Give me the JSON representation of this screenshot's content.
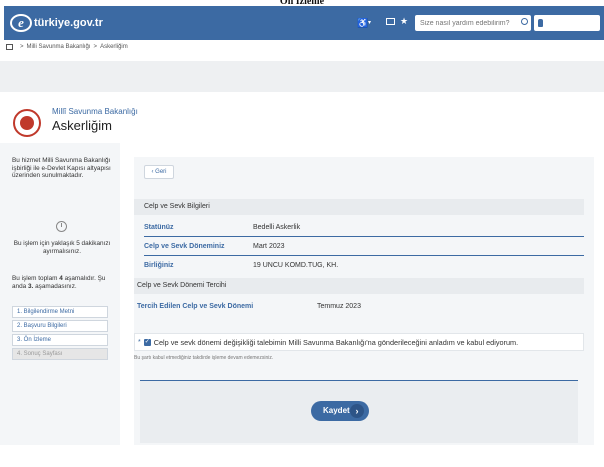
{
  "page_caption": "Ön İzleme",
  "header": {
    "logo_mark": "e",
    "logo_text": "türkiye.gov.tr",
    "accessibility_icon": "♿",
    "accessibility_caret": "▾",
    "favorite_icon": "★",
    "search_placeholder": "Size nasıl yardım edebilirim?"
  },
  "breadcrumb": {
    "sep": ">",
    "items": [
      "Milli Savunma Bakanlığı",
      "Askerliğim"
    ]
  },
  "institution": {
    "name": "Millî Savunma Bakanlığı",
    "service": "Askerliğim"
  },
  "sidebar": {
    "description": "Bu hizmet Milli Savunma Bakanlığı işbirliği ile e-Devlet Kapısı altyapısı üzerinden sunulmaktadır.",
    "duration": "Bu işlem için yaklaşık 5 dakikanızı ayırmalısınız.",
    "steps_info_a": "Bu işlem toplam ",
    "steps_total": "4",
    "steps_info_b": " aşamalıdır. Şu anda ",
    "steps_current": "3.",
    "steps_info_c": " aşamadasınız.",
    "steps": [
      {
        "label": "1. Bilgilendirme Metni"
      },
      {
        "label": "2. Başvuru Bilgileri"
      },
      {
        "label": "3. Ön İzleme"
      },
      {
        "label": "4. Sonuç Sayfası"
      }
    ]
  },
  "main": {
    "back_label": "Geri",
    "back_arrow": "‹",
    "section1_title": "Celp ve Sevk Bilgileri",
    "fields": [
      {
        "label": "Statünüz",
        "value": "Bedelli Askerlik"
      },
      {
        "label": "Celp ve Sevk Döneminiz",
        "value": "Mart 2023"
      },
      {
        "label": "Birliğiniz",
        "value": "19 UNCU KOMD.TUG, KH."
      }
    ],
    "section2_title": "Celp ve Sevk  Dönemi Tercihi",
    "preference_label": "Tercih Edilen Celp ve Sevk Dönemi",
    "preference_value": "Temmuz 2023",
    "consent_required_mark": "*",
    "consent_check": "✓",
    "consent_text": "Celp ve sevk dönemi değişikliği talebimin Milli Savunma Bakanlığı'na gönderileceğini anladım ve kabul ediyorum.",
    "consent_note": "Bu şartı kabul etmediğiniz takdirde işleme devam edemezsiniz.",
    "save_label": "Kaydet",
    "save_arrow": "›"
  }
}
